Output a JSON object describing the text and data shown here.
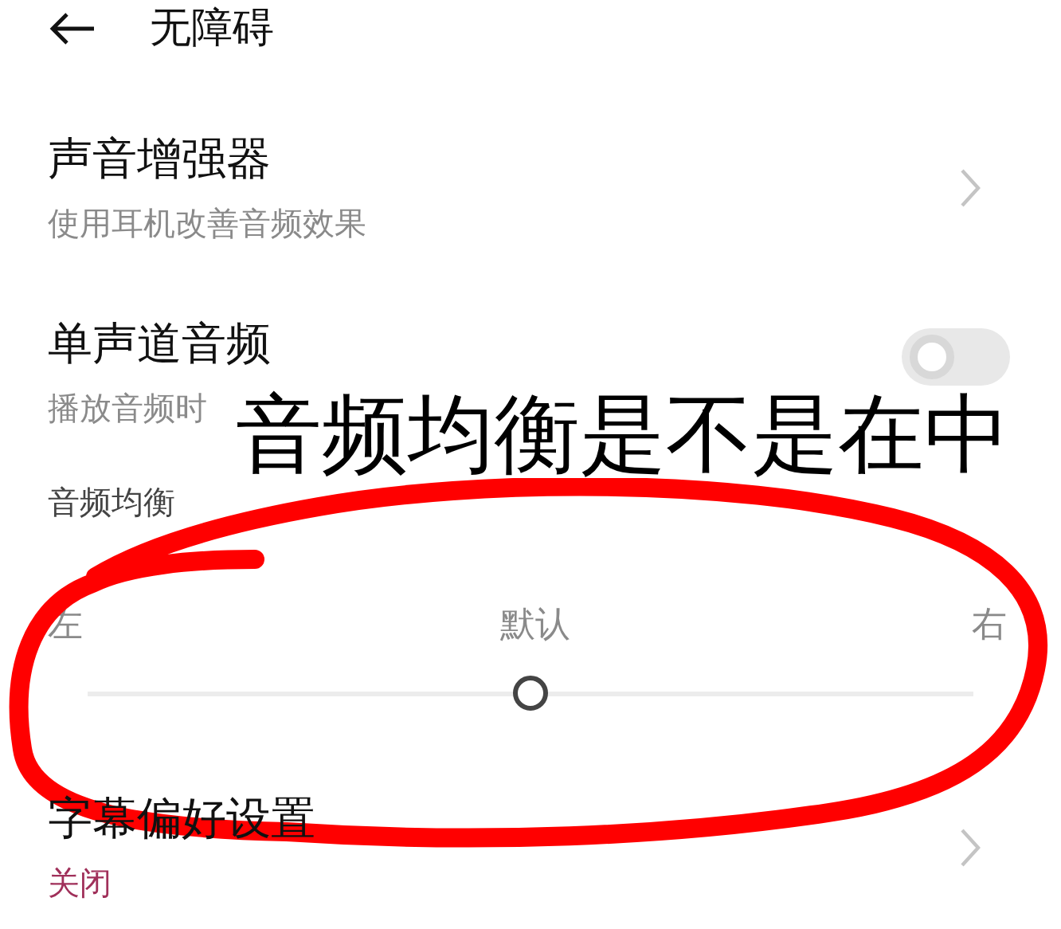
{
  "header": {
    "title": "无障碍"
  },
  "items": [
    {
      "kind": "link",
      "title": "声音增强器",
      "subtitle": "使用耳机改善音频效果"
    },
    {
      "kind": "toggle",
      "title": "单声道音频",
      "subtitle": "播放音频时",
      "on": false
    }
  ],
  "balance": {
    "label": "音频均衡",
    "left": "左",
    "center": "默认",
    "right": "右",
    "level": 0.5
  },
  "items_after": [
    {
      "kind": "link",
      "title": "字幕偏好设置",
      "value": "关闭"
    }
  ],
  "annotation": {
    "text": "音频均衡是不是在中"
  }
}
